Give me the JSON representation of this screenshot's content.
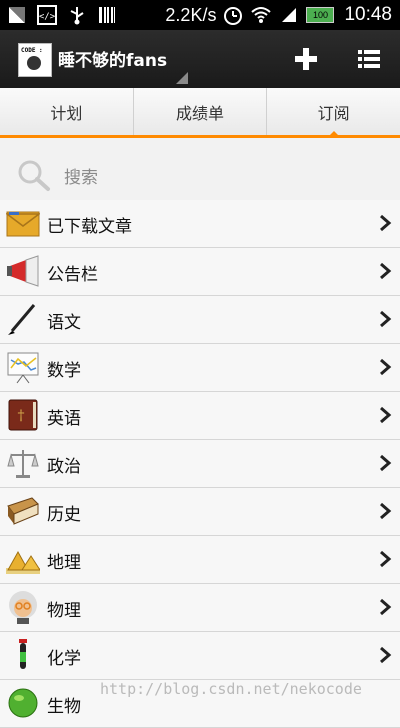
{
  "status_bar": {
    "speed": "2.2K/s",
    "battery": "100",
    "time": "10:48",
    "icons": [
      "signal-app-icon",
      "code-icon",
      "usb-icon",
      "barcode-icon",
      "alarm-icon",
      "wifi-icon",
      "signal-icon"
    ]
  },
  "action_bar": {
    "logo_text": "CODE :",
    "title": "睡不够的fans",
    "add_icon": "plus-icon",
    "menu_icon": "list-icon"
  },
  "tabs": [
    {
      "label": "计划"
    },
    {
      "label": "成绩单"
    },
    {
      "label": "订阅",
      "selected": true
    }
  ],
  "search": {
    "placeholder": "搜索"
  },
  "list": [
    {
      "label": "已下载文章",
      "icon": "folder-icon"
    },
    {
      "label": "公告栏",
      "icon": "megaphone-icon"
    },
    {
      "label": "语文",
      "icon": "brush-icon"
    },
    {
      "label": "数学",
      "icon": "chart-board-icon"
    },
    {
      "label": "英语",
      "icon": "book-icon"
    },
    {
      "label": "政治",
      "icon": "scales-icon"
    },
    {
      "label": "历史",
      "icon": "old-book-icon"
    },
    {
      "label": "地理",
      "icon": "pyramid-icon"
    },
    {
      "label": "物理",
      "icon": "einstein-icon"
    },
    {
      "label": "化学",
      "icon": "test-tube-icon"
    },
    {
      "label": "生物",
      "icon": "globe-icon"
    }
  ],
  "watermark": "http://blog.csdn.net/nekocode",
  "colors": {
    "accent": "#ff8a00",
    "action_bar": "#222222"
  }
}
